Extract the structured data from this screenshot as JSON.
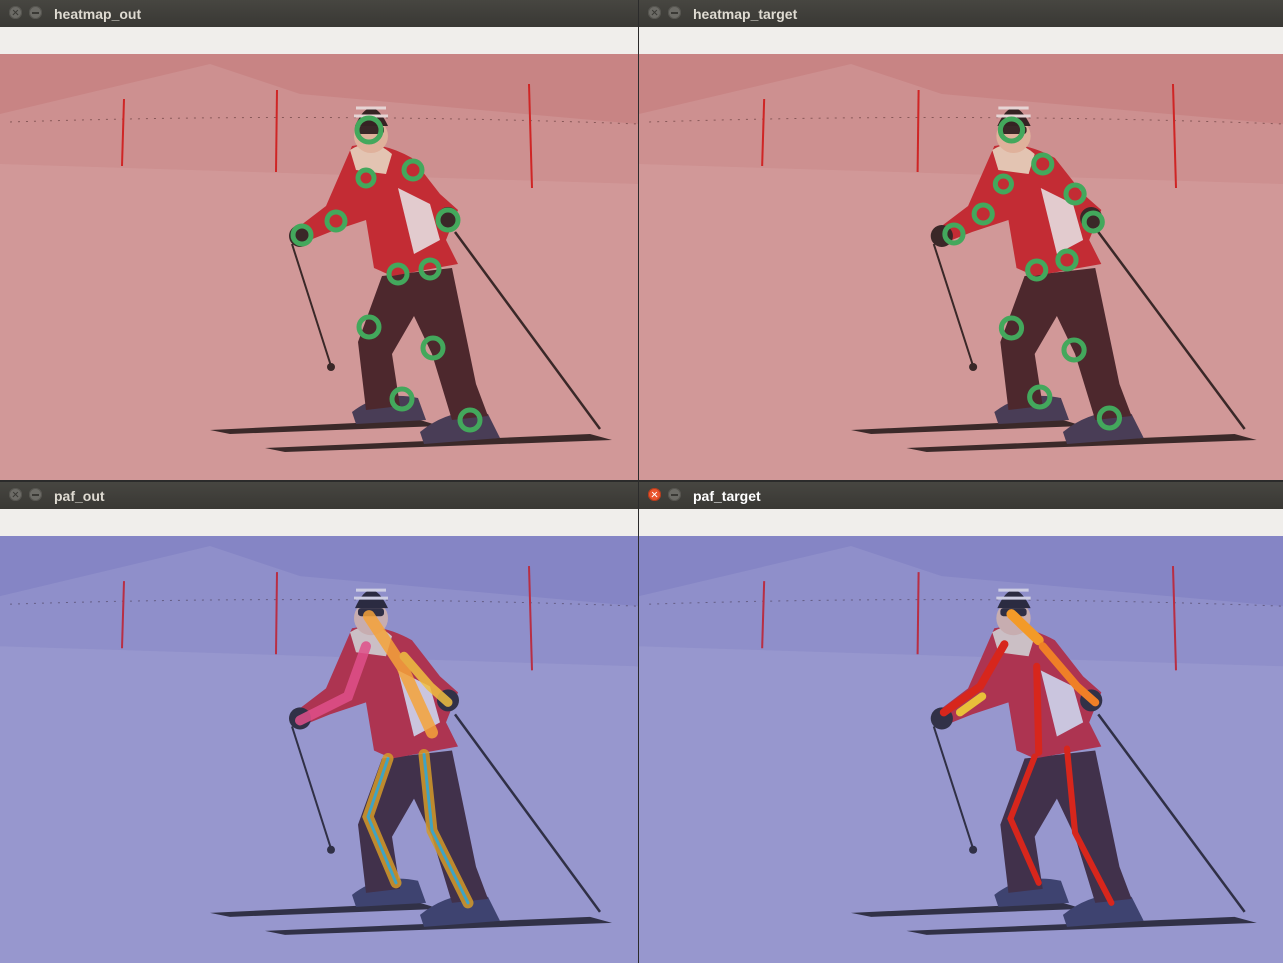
{
  "windows": [
    {
      "key": "heatmap_out",
      "title": "heatmap_out",
      "active": false
    },
    {
      "key": "heatmap_target",
      "title": "heatmap_target",
      "active": false
    },
    {
      "key": "paf_out",
      "title": "paf_out",
      "active": false
    },
    {
      "key": "paf_target",
      "title": "paf_target",
      "active": true
    }
  ],
  "colors": {
    "heatmap_tint": "#c98c8c",
    "paf_tint": "#8c8cc4",
    "keypoint_ring": "#43a85c",
    "paf_target_limb": "#d7261c"
  },
  "icons": {
    "close": "close-icon",
    "minimize": "minimize-icon"
  }
}
